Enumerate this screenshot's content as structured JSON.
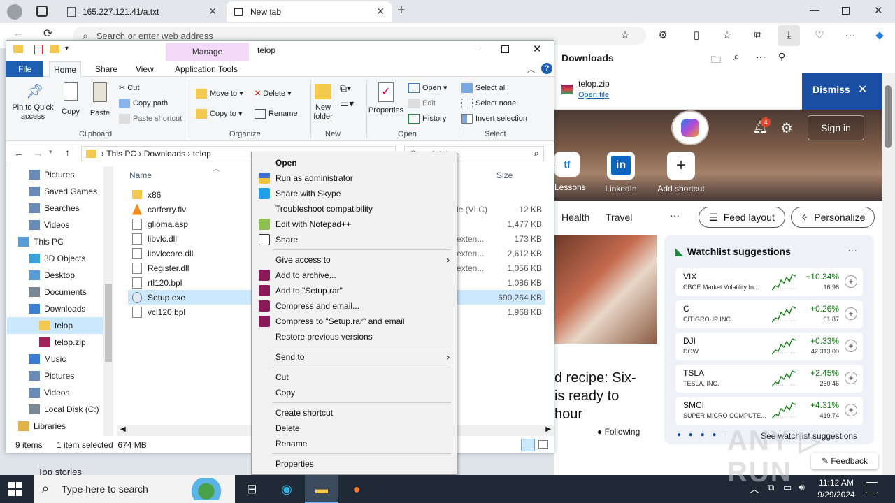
{
  "browser": {
    "tabs": [
      {
        "title": "165.227.121.41/a.txt"
      },
      {
        "title": "New tab"
      }
    ],
    "address_placeholder": "Search or enter web address",
    "downloads": {
      "title": "Downloads",
      "file": "telop.zip",
      "open_link": "Open file",
      "dismiss": "Dismiss"
    },
    "newtab": {
      "signin": "Sign in",
      "notif_count": "4",
      "shortcuts": [
        "Lessons",
        "LinkedIn",
        "Add shortcut"
      ],
      "nav": [
        "Health",
        "Travel",
        "···"
      ],
      "feed_layout": "Feed layout",
      "personalize": "Personalize",
      "article_lines": [
        "d recipe: Six-",
        "is ready to",
        "hour"
      ],
      "following": "Following",
      "watchlist_title": "Watchlist suggestions",
      "watchlist": [
        {
          "sym": "VIX",
          "name": "CBOE Market Volatility In...",
          "chg": "+10.34%",
          "price": "16.96"
        },
        {
          "sym": "C",
          "name": "CITIGROUP INC.",
          "chg": "+0.26%",
          "price": "61.87"
        },
        {
          "sym": "DJI",
          "name": "DOW",
          "chg": "+0.33%",
          "price": "42,313.00"
        },
        {
          "sym": "TSLA",
          "name": "TESLA, INC.",
          "chg": "+2.45%",
          "price": "260.46"
        },
        {
          "sym": "SMCI",
          "name": "SUPER MICRO COMPUTE...",
          "chg": "+4.31%",
          "price": "419.74"
        }
      ],
      "see_watchlist": "See watchlist suggestions",
      "feedback": "Feedback",
      "top_stories": "Top stories"
    }
  },
  "explorer": {
    "title": "telop",
    "manage_tab": "Manage",
    "ribbon_tabs": [
      "File",
      "Home",
      "Share",
      "View",
      "Application Tools"
    ],
    "clipboard": {
      "pin": "Pin to Quick access",
      "copy": "Copy",
      "paste": "Paste",
      "cut": "Cut",
      "copy_path": "Copy path",
      "paste_shortcut": "Paste shortcut",
      "caption": "Clipboard"
    },
    "organize": {
      "move_to": "Move to",
      "copy_to": "Copy to",
      "delete": "Delete",
      "rename": "Rename",
      "caption": "Organize"
    },
    "new": {
      "new_folder": "New folder",
      "caption": "New"
    },
    "open": {
      "properties": "Properties",
      "open": "Open",
      "edit": "Edit",
      "history": "History",
      "caption": "Open"
    },
    "select": {
      "select_all": "Select all",
      "select_none": "Select none",
      "invert": "Invert selection",
      "caption": "Select"
    },
    "path": [
      "This PC",
      "Downloads",
      "telop"
    ],
    "search_placeholder": "Search telop",
    "columns": {
      "name": "Name",
      "size": "Size"
    },
    "nav": [
      {
        "label": "Pictures",
        "indent": 1
      },
      {
        "label": "Saved Games",
        "indent": 1
      },
      {
        "label": "Searches",
        "indent": 1
      },
      {
        "label": "Videos",
        "indent": 1
      },
      {
        "label": "This PC",
        "indent": 0
      },
      {
        "label": "3D Objects",
        "indent": 1
      },
      {
        "label": "Desktop",
        "indent": 1
      },
      {
        "label": "Documents",
        "indent": 1
      },
      {
        "label": "Downloads",
        "indent": 1
      },
      {
        "label": "telop",
        "indent": 2
      },
      {
        "label": "telop.zip",
        "indent": 2
      },
      {
        "label": "Music",
        "indent": 1
      },
      {
        "label": "Pictures",
        "indent": 1
      },
      {
        "label": "Videos",
        "indent": 1
      },
      {
        "label": "Local Disk (C:)",
        "indent": 1
      },
      {
        "label": "Libraries",
        "indent": 0
      }
    ],
    "files": [
      {
        "name": "x86",
        "type": "",
        "size": ""
      },
      {
        "name": "carferry.flv",
        "type": "le (VLC)",
        "size": "12 KB"
      },
      {
        "name": "glioma.asp",
        "type": "",
        "size": "1,477 KB"
      },
      {
        "name": "libvlc.dll",
        "type": "exten...",
        "size": "173 KB"
      },
      {
        "name": "libvlccore.dll",
        "type": "exten...",
        "size": "2,612 KB"
      },
      {
        "name": "Register.dll",
        "type": "exten...",
        "size": "1,056 KB"
      },
      {
        "name": "rtl120.bpl",
        "type": "",
        "size": "1,086 KB"
      },
      {
        "name": "Setup.exe",
        "type": "",
        "size": "690,264 KB"
      },
      {
        "name": "vcl120.bpl",
        "type": "",
        "size": "1,968 KB"
      }
    ],
    "status": {
      "items": "9 items",
      "selected": "1 item selected  674 MB"
    }
  },
  "context_menu": [
    {
      "label": "Open",
      "bold": true
    },
    {
      "label": "Run as administrator"
    },
    {
      "label": "Share with Skype"
    },
    {
      "label": "Troubleshoot compatibility"
    },
    {
      "label": "Edit with Notepad++"
    },
    {
      "label": "Share"
    },
    {
      "sep": true
    },
    {
      "label": "Give access to",
      "arrow": true
    },
    {
      "label": "Add to archive..."
    },
    {
      "label": "Add to \"Setup.rar\""
    },
    {
      "label": "Compress and email..."
    },
    {
      "label": "Compress to \"Setup.rar\" and email"
    },
    {
      "label": "Restore previous versions"
    },
    {
      "sep": true
    },
    {
      "label": "Send to",
      "arrow": true
    },
    {
      "sep": true
    },
    {
      "label": "Cut"
    },
    {
      "label": "Copy"
    },
    {
      "sep": true
    },
    {
      "label": "Create shortcut"
    },
    {
      "label": "Delete"
    },
    {
      "label": "Rename"
    },
    {
      "sep": true
    },
    {
      "label": "Properties"
    }
  ],
  "taskbar": {
    "search_placeholder": "Type here to search",
    "time": "11:12 AM",
    "date": "9/29/2024"
  },
  "colors": {
    "accent": "#1a4ea3",
    "selection": "#cce8ff",
    "manage_tab": "#f3d9f8",
    "file_tab": "#1e5fb4"
  }
}
